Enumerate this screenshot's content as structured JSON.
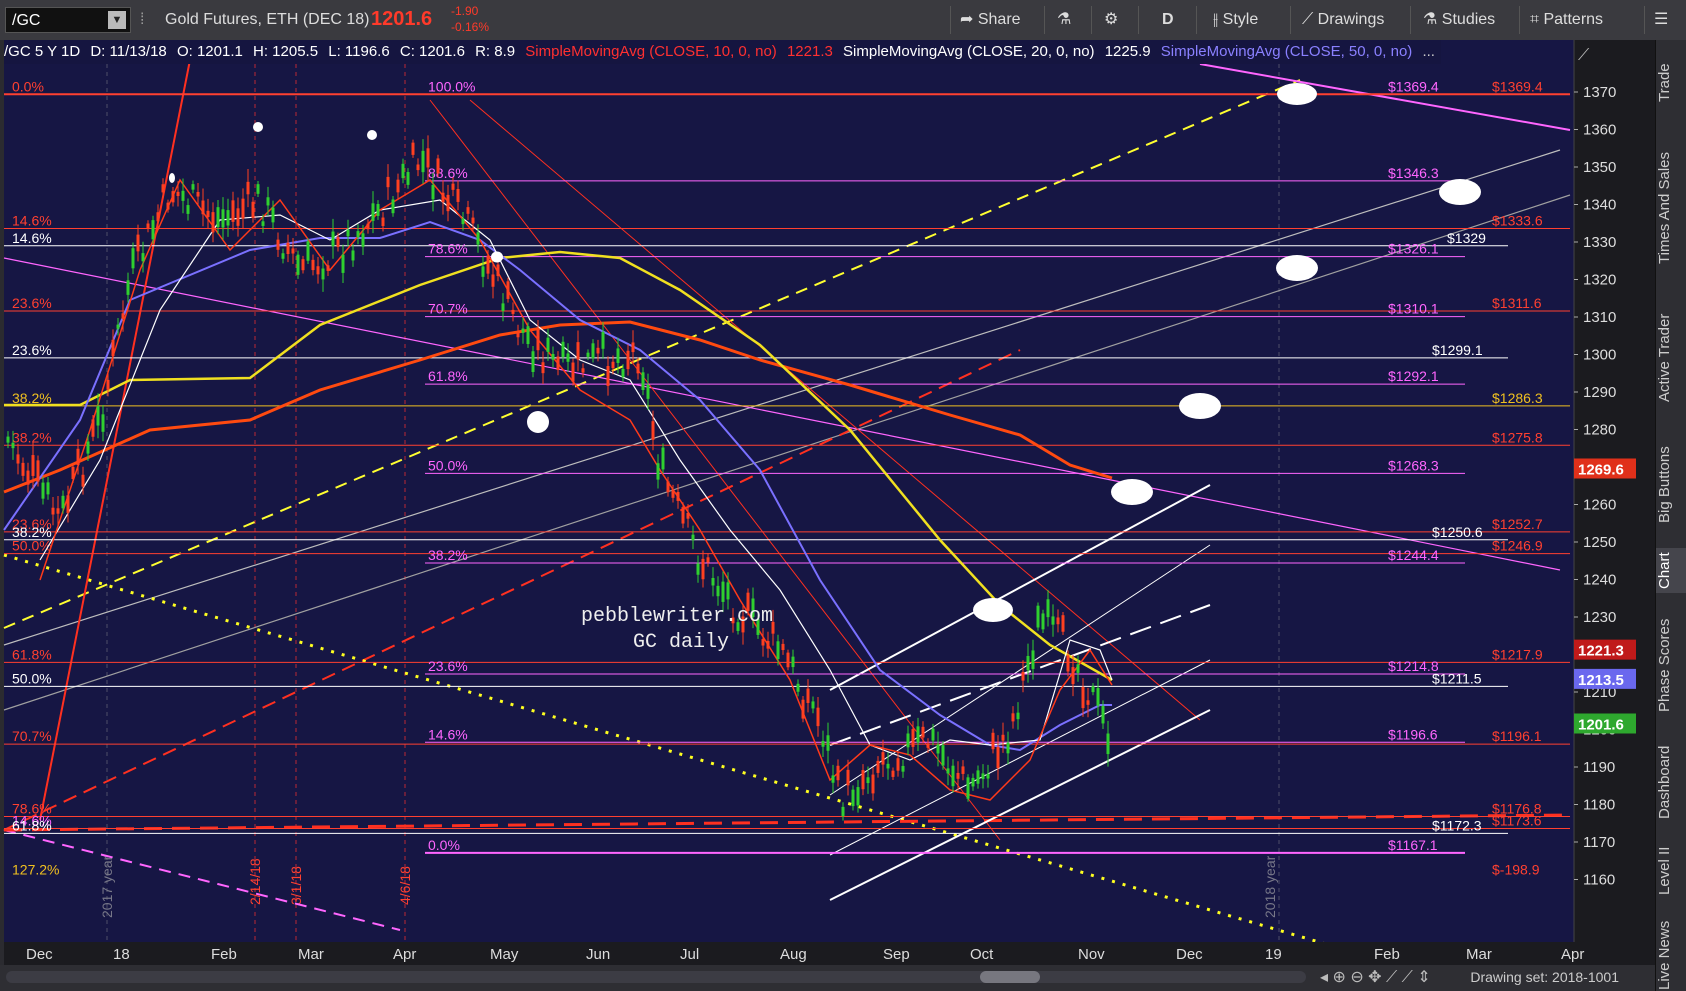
{
  "toolbar": {
    "symbol": "/GC",
    "instrument": "Gold Futures, ETH (DEC 18)",
    "last": "1201.6",
    "change": "-1.90",
    "change_pct": "-0.16%",
    "share": "Share",
    "period": "D",
    "style": "Style",
    "drawings": "Drawings",
    "studies": "Studies",
    "patterns": "Patterns"
  },
  "info": {
    "symbol": "/GC 5 Y 1D",
    "date": "D: 11/13/18",
    "open": "O: 1201.1",
    "high": "H: 1205.5",
    "low": "L: 1196.6",
    "close": "C: 1201.6",
    "range": "R: 8.9",
    "sma10_label": "SimpleMovingAvg (CLOSE, 10, 0, no)",
    "sma10_value": "1221.3",
    "sma20_label": "SimpleMovingAvg (CLOSE, 20, 0, no)",
    "sma20_value": "1225.9",
    "sma50_label": "SimpleMovingAvg (CLOSE, 50, 0, no)"
  },
  "watermark": {
    "line1": "pebblewriter.com",
    "line2": "GC daily"
  },
  "colors": {
    "background": "#161644",
    "up_candle": "#2fd02f",
    "down_candle": "#ff4020",
    "sma10": "#ff3a1a",
    "sma20": "#ffffff",
    "sma50": "#7a70ff",
    "sma100": "#f0e020",
    "sma200": "#ff4a10",
    "fib_pink": "#ff66ff",
    "fib_red": "#ff4030"
  },
  "price_axis": [
    "1370",
    "1360",
    "1350",
    "1340",
    "1330",
    "1320",
    "1310",
    "1300",
    "1290",
    "1280",
    "1270",
    "1260",
    "1250",
    "1240",
    "1230",
    "1220",
    "1210",
    "1200",
    "1190",
    "1180",
    "1170",
    "1160"
  ],
  "time_axis": [
    "Dec",
    "18",
    "Feb",
    "Mar",
    "Apr",
    "May",
    "Jun",
    "Jul",
    "Aug",
    "Sep",
    "Oct",
    "Nov",
    "Dec",
    "19",
    "Feb",
    "Mar",
    "Apr"
  ],
  "price_badges": [
    {
      "label": "1269.6",
      "color": "#e0301a"
    },
    {
      "label": "1221.3",
      "color": "#c01a1a"
    },
    {
      "label": "1213.5",
      "color": "#6a68ee"
    },
    {
      "label": "1201.6",
      "color": "#2ea82e"
    }
  ],
  "fib_left": [
    {
      "label": "0.0%",
      "color": "#ff4030"
    },
    {
      "label": "14.6%",
      "color": "#ff4030"
    },
    {
      "label": "14.6%",
      "color": "#ffffff"
    },
    {
      "label": "23.6%",
      "color": "#ff4030"
    },
    {
      "label": "23.6%",
      "color": "#ffffff"
    },
    {
      "label": "38.2%",
      "color": "#f0c020"
    },
    {
      "label": "38.2%",
      "color": "#ff4030"
    },
    {
      "label": "23.6%",
      "color": "#ff4030"
    },
    {
      "label": "38.2%",
      "color": "#ffffff"
    },
    {
      "label": "50.0%",
      "color": "#ff4030"
    },
    {
      "label": "61.8%",
      "color": "#ff4030"
    },
    {
      "label": "50.0%",
      "color": "#ffffff"
    },
    {
      "label": "70.7%",
      "color": "#ff4030"
    },
    {
      "label": "78.6%",
      "color": "#ff4030"
    },
    {
      "label": "14.6%",
      "color": "#ff66ff"
    },
    {
      "label": "61.8%",
      "color": "#ffffff"
    },
    {
      "label": "127.2%",
      "color": "#f0c020"
    }
  ],
  "fib_mid": [
    "100.0%",
    "88.6%",
    "78.6%",
    "70.7%",
    "61.8%",
    "50.0%",
    "38.2%",
    "23.6%",
    "14.6%",
    "0.0%"
  ],
  "fib_right_pink": [
    "$1369.4",
    "$1346.3",
    "$1326.1",
    "$1310.1",
    "$1292.1",
    "$1268.3",
    "$1244.4",
    "$1214.8",
    "$1196.6",
    "$1167.1"
  ],
  "fib_right_white": [
    "$1329",
    "$1299.1",
    "$1250.6",
    "$1211.5",
    "$1172.3"
  ],
  "fib_right_red": [
    "$1369.4",
    "$1333.6",
    "$1311.6",
    "$1286.3",
    "$1275.8",
    "$1252.7",
    "$1246.9",
    "$1217.9",
    "$1196.1",
    "$1176.8",
    "$1173.6",
    "$-198.9"
  ],
  "vertical_labels": [
    "2/14/18",
    "3/1/18",
    "4/6/18",
    "2017 year",
    "2018 year"
  ],
  "right_tabs": [
    "Trade",
    "Times And Sales",
    "Active Trader",
    "Big Buttons",
    "Chart",
    "Phase Scores",
    "Dashboard",
    "Level II",
    "Live News"
  ],
  "drawing_set": "Drawing set: 2018-1001"
}
